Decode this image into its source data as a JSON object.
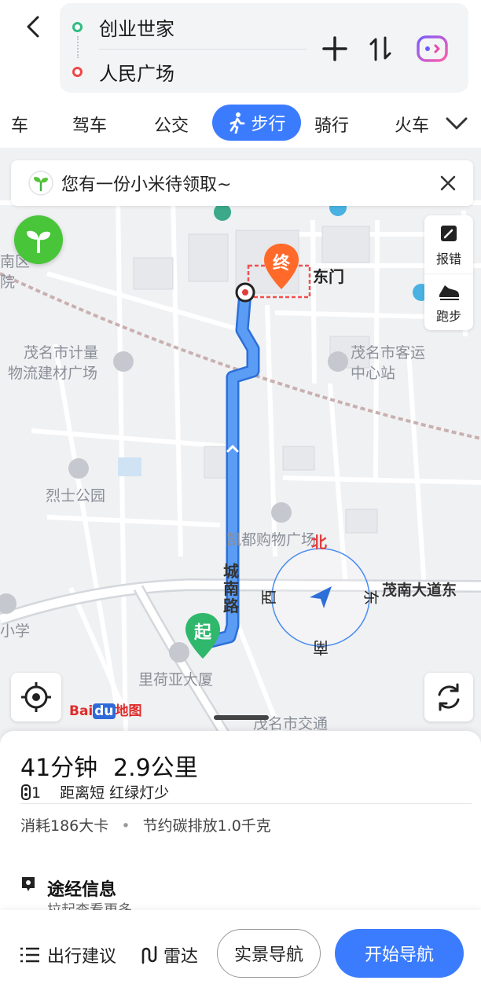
{
  "route": {
    "start": "创业世家",
    "end": "人民广场"
  },
  "mode_tabs": [
    "车",
    "驾车",
    "公交",
    "步行",
    "骑行",
    "火车"
  ],
  "active_mode": "步行",
  "promo": {
    "text": "您有一份小米待领取~"
  },
  "side_tools": {
    "report": "报错",
    "run": "跑步"
  },
  "map": {
    "pois": [
      "南区",
      "院",
      "东门",
      "茂名市计量",
      "物流建材广场",
      "茂名市客运",
      "中心站",
      "烈士公园",
      "凯都购物广场",
      "小学",
      "里荷亚大厦",
      "茂名市交通"
    ],
    "roads": [
      "城南路",
      "茂南大道东"
    ],
    "markers": {
      "end": "终",
      "start": "起"
    },
    "compass": {
      "north": "北",
      "east": "东",
      "south": "南",
      "west": "西"
    },
    "brand": {
      "part1": "Bai",
      "part2": "du",
      "part3": "地图"
    }
  },
  "summary": {
    "time": "41分钟",
    "distance": "2.9公里",
    "lights_count": "1",
    "tags": "距离短 红绿灯少",
    "calories": "消耗186大卡",
    "separator": "•",
    "carbon": "节约碳排放1.0千克"
  },
  "via": {
    "title": "途经信息",
    "subtitle": "拉起查看更多"
  },
  "actions": {
    "advice": "出行建议",
    "radar": "雷达",
    "ar": "实景导航",
    "start": "开始导航"
  },
  "colors": {
    "accent": "#3b7cff",
    "route": "#4a8df0",
    "start_marker": "#2fb86c",
    "end_marker": "#ff6a2a"
  }
}
